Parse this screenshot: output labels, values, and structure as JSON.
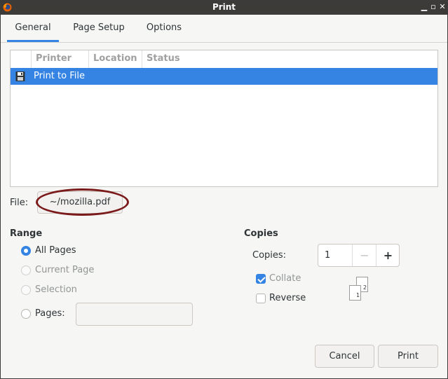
{
  "window": {
    "title": "Print"
  },
  "tabs": [
    {
      "label": "General",
      "active": true
    },
    {
      "label": "Page Setup",
      "active": false
    },
    {
      "label": "Options",
      "active": false
    }
  ],
  "printer_list": {
    "columns": [
      "Printer",
      "Location",
      "Status"
    ],
    "rows": [
      {
        "name": "Print to File",
        "icon": "floppy-disk-icon",
        "selected": true
      }
    ]
  },
  "file": {
    "label": "File:",
    "value": "~/mozilla.pdf"
  },
  "range": {
    "title": "Range",
    "options": [
      {
        "label": "All Pages",
        "checked": true,
        "enabled": true
      },
      {
        "label": "Current Page",
        "checked": false,
        "enabled": false
      },
      {
        "label": "Selection",
        "checked": false,
        "enabled": false
      },
      {
        "label": "Pages:",
        "checked": false,
        "enabled": true
      }
    ],
    "pages_value": ""
  },
  "copies": {
    "title": "Copies",
    "label": "Copies:",
    "value": "1",
    "minus": "−",
    "plus": "+",
    "collate": {
      "label": "Collate",
      "checked": true
    },
    "reverse": {
      "label": "Reverse",
      "checked": false
    },
    "preview_pages": [
      "1",
      "2"
    ]
  },
  "buttons": {
    "cancel": "Cancel",
    "print": "Print"
  },
  "colors": {
    "accent": "#3584e4",
    "titlebar": "#3c3b37",
    "annotation": "#7a1a1a"
  }
}
